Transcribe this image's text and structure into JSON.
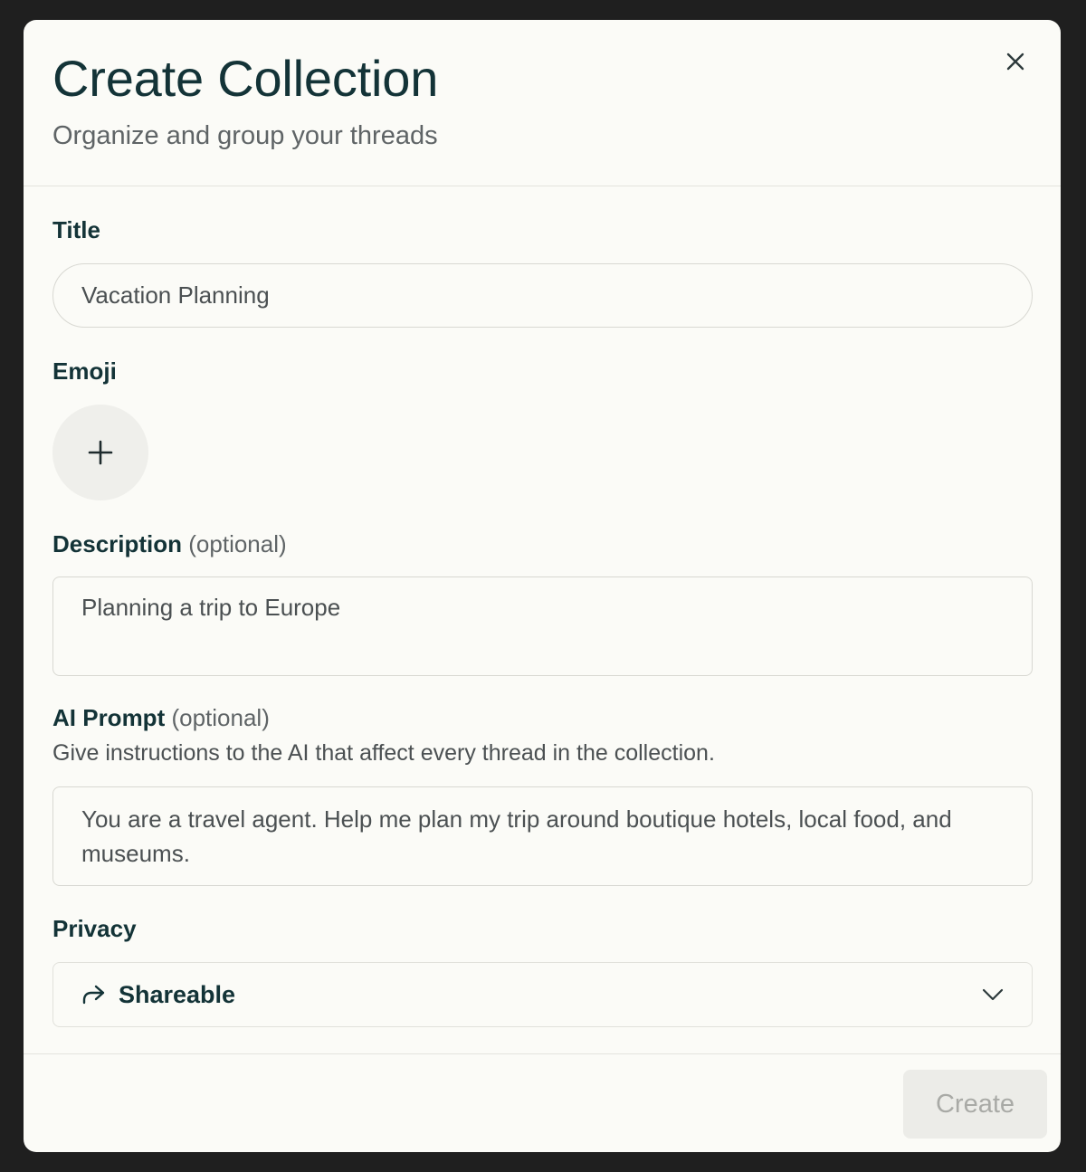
{
  "modal": {
    "title": "Create Collection",
    "subtitle": "Organize and group your threads"
  },
  "form": {
    "title_label": "Title",
    "title_value": "Vacation Planning",
    "emoji_label": "Emoji",
    "description_label": "Description",
    "optional_text": "(optional)",
    "description_value": "Planning a trip to Europe",
    "prompt_label": "AI Prompt",
    "prompt_hint": "Give instructions to the AI that affect every thread in the collection.",
    "prompt_value": "You are a travel agent. Help me plan my trip around boutique hotels, local food, and museums.",
    "privacy_label": "Privacy",
    "privacy_value": "Shareable"
  },
  "footer": {
    "create_label": "Create"
  },
  "icons": {
    "close": "close-icon",
    "add": "plus-icon",
    "privacy": "share-arrow-icon",
    "dropdown": "chevron-down-icon"
  },
  "colors": {
    "primary_text": "#133337",
    "muted_text": "#5f6466",
    "modal_bg": "#fbfbf7",
    "disabled_button_bg": "#ecece8"
  }
}
